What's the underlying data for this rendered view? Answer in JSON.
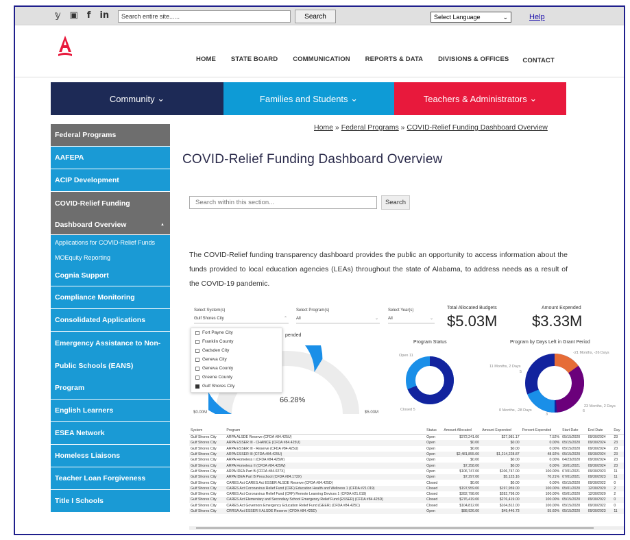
{
  "topbar": {
    "social": [
      "𝕪",
      "▣",
      "f",
      "in"
    ],
    "search_value": "Search entire site......",
    "search_button": "Search",
    "language_selected": "Select Language",
    "help": "Help"
  },
  "brand": {
    "accent": "#e8193c",
    "navy": "#1d2a56",
    "blue": "#1a9ad5"
  },
  "mainnav": [
    "HOME",
    "STATE BOARD",
    "COMMUNICATION",
    "REPORTS & DATA",
    "DIVISIONS & OFFICES",
    "CONTACT"
  ],
  "meganav": [
    "Community",
    "Families and Students",
    "Teachers & Administrators"
  ],
  "sidebar": [
    {
      "label": "Federal Programs",
      "style": "gray"
    },
    {
      "label": "AAFEPA",
      "style": "blue"
    },
    {
      "label": "ACIP Development",
      "style": "blue"
    },
    {
      "label": "COVID-Relief Funding",
      "style": "gray"
    },
    {
      "label": "Dashboard Overview",
      "style": "gray",
      "expanded": true
    },
    {
      "label": "Applications for COVID-Relief Funds",
      "style": "sub"
    },
    {
      "label": "MOEquity Reporting",
      "style": "sub"
    },
    {
      "label": "Cognia Support",
      "style": "blue"
    },
    {
      "label": "Compliance Monitoring",
      "style": "blue"
    },
    {
      "label": "Consolidated Applications",
      "style": "blue"
    },
    {
      "label": "Emergency Assistance to Non-",
      "style": "blue"
    },
    {
      "label": "Public Schools (EANS)",
      "style": "blue"
    },
    {
      "label": "Program",
      "style": "blue"
    },
    {
      "label": "English Learners",
      "style": "blue"
    },
    {
      "label": "ESEA Network",
      "style": "blue"
    },
    {
      "label": "Homeless Liaisons",
      "style": "blue"
    },
    {
      "label": "Teacher Loan Forgiveness",
      "style": "blue"
    },
    {
      "label": "Title I Schools",
      "style": "blue"
    }
  ],
  "breadcrumb": {
    "home": "Home",
    "sep": " » ",
    "parent": "Federal Programs",
    "current": "COVID-Relief Funding Dashboard Overview"
  },
  "page_title": "COVID-Relief Funding Dashboard Overview",
  "section_search": {
    "placeholder": "Search within this section...",
    "button": "Search"
  },
  "intro": "The COVID-Relief funding transparency dashboard provides the public an opportunity to access information about the funds provided to local education agencies (LEAs) throughout the state of Alabama, to address needs as a result of the COVID-19 pandemic.",
  "dashboard": {
    "filters": [
      {
        "label": "Select System(s)",
        "value": "Gulf Shores City"
      },
      {
        "label": "Select Program(s)",
        "value": "All"
      },
      {
        "label": "Select Year(s)",
        "value": "All"
      }
    ],
    "system_options": [
      {
        "label": "Fort Payne City",
        "checked": false
      },
      {
        "label": "Franklin County",
        "checked": false
      },
      {
        "label": "Gadsden City",
        "checked": false
      },
      {
        "label": "Geneva City",
        "checked": false
      },
      {
        "label": "Geneva County",
        "checked": false
      },
      {
        "label": "Greene County",
        "checked": false
      },
      {
        "label": "Gulf Shores City",
        "checked": true
      }
    ],
    "kpis": [
      {
        "label": "Total Allocated Budgets",
        "value": "$5.03M"
      },
      {
        "label": "Amount Expended",
        "value": "$3.33M"
      }
    ],
    "charts": {
      "gauge_title": "pended",
      "gauge_percent": "66.28%",
      "gauge_min": "$0.00M",
      "gauge_max": "$5.03M",
      "gauge_fraction": 0.6628,
      "status_title": "Program Status",
      "status_open": "Open 11",
      "status_closed": "Closed 5",
      "days_title": "Program by Days Left in Grant Period",
      "days_labels": [
        "-21 Months, -26 Days",
        "11 Months, 2 Days",
        "5",
        "0 Months, -28 Days",
        "3",
        "23 Months, 2 Days",
        "6"
      ]
    },
    "table": {
      "columns": [
        "System",
        "Program",
        "Status",
        "Amount Allocated",
        "Amount Expended",
        "Percent Expended",
        "Start Date",
        "End Date",
        "Day"
      ],
      "rows": [
        [
          "Gulf Shores City",
          "ARPA   ALSDE Reserve (CFDA #84.425U)",
          "Open",
          "$372,241.00",
          "$27,981.17",
          "7.52%",
          "05/15/2020",
          "09/30/2024",
          "23"
        ],
        [
          "Gulf Shores City",
          "ARPA   ESSER III - CHANCE (CFDA #84.425U)",
          "Open",
          "$0.00",
          "$0.00",
          "0.00%",
          "05/15/2020",
          "09/30/2024",
          "23"
        ],
        [
          "Gulf Shores City",
          "ARPA   ESSER III - Reserve (CFDA #84.425U)",
          "Open",
          "$0.00",
          "$0.00",
          "0.00%",
          "05/15/2020",
          "09/30/2024",
          "23"
        ],
        [
          "Gulf Shores City",
          "ARPA   ESSER III (CFDA #84.425U)",
          "Open",
          "$2,481,855.00",
          "$1,214,228.87",
          "48.92%",
          "05/15/2020",
          "09/30/2024",
          "23"
        ],
        [
          "Gulf Shores City",
          "ARPA   Homeless I (CFDA #84.425W)",
          "Open",
          "$0.00",
          "$0.00",
          "0.00%",
          "04/23/2020",
          "09/30/2024",
          "23"
        ],
        [
          "Gulf Shores City",
          "ARPA   Homeless II (CFDA #84.425W)",
          "Open",
          "$7,258.00",
          "$0.00",
          "0.00%",
          "10/01/2021",
          "09/30/2024",
          "23"
        ],
        [
          "Gulf Shores City",
          "ARPA   IDEA Part B (CFDA #84.027X)",
          "Open",
          "$106,747.00",
          "$106,747.00",
          "100.00%",
          "07/01/2021",
          "09/30/2023",
          "11"
        ],
        [
          "Gulf Shores City",
          "ARPA   IDEA Part B Preschool (CFDA #84.173X)",
          "Open",
          "$7,297.00",
          "$5,123.16",
          "70.21%",
          "07/01/2021",
          "09/30/2023",
          "11"
        ],
        [
          "Gulf Shores City",
          "CARES Act   CARES Act   ESSER  ALSDE Reserve (CFDA #84.425D)",
          "Closed",
          "$0.00",
          "$0.00",
          "0.00%",
          "05/15/2020",
          "09/30/2022",
          "0"
        ],
        [
          "Gulf Shores City",
          "CARES Act   Coronavirus Relief Fund (CRF)   Education Health and Wellness 1 (CFDA #21.019)",
          "Closed",
          "$197,959.00",
          "$197,959.00",
          "100.00%",
          "05/01/2020",
          "12/30/2020",
          "2"
        ],
        [
          "Gulf Shores City",
          "CARES Act   Coronavirus Relief Fund (CRF)   Remote Learning Devices 1 (CFDA #21.019)",
          "Closed",
          "$282,798.00",
          "$282,798.00",
          "100.00%",
          "05/01/2020",
          "12/30/2020",
          "2"
        ],
        [
          "Gulf Shores City",
          "CARES Act   Elementary and Secondary School Emergency Relief Fund (ESSER) (CFDA #84.425D)",
          "Closed",
          "$276,419.00",
          "$276,419.00",
          "100.00%",
          "05/15/2020",
          "09/30/2022",
          "0"
        ],
        [
          "Gulf Shores City",
          "CARES Act   Governors Emergency Education Relief Fund (GEER) (CFDA #84.425C)",
          "Closed",
          "$104,812.00",
          "$104,812.00",
          "100.00%",
          "05/15/2020",
          "09/30/2022",
          "0"
        ],
        [
          "Gulf Shores City",
          "CRRSA Act   ESSER II   ALSDE Reserve (CFDA #84.425D)",
          "Open",
          "$88,926.00",
          "$49,446.73",
          "55.60%",
          "05/15/2020",
          "09/30/2023",
          "11"
        ]
      ]
    }
  }
}
